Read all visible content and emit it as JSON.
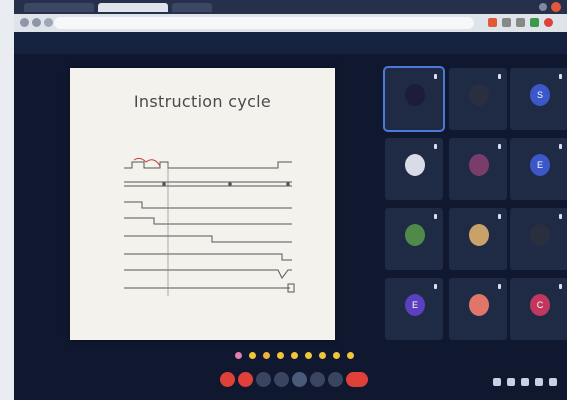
{
  "browser": {
    "tabs": [
      "",
      "",
      ""
    ],
    "url": ""
  },
  "presenter_bar": {
    "text": ""
  },
  "slide": {
    "title": "Instruction cycle",
    "note": "",
    "subtitle": "",
    "signals": [
      "",
      "",
      "",
      "",
      "",
      "",
      "",
      ""
    ]
  },
  "participants": [
    {
      "name": "",
      "avatar_letter": "",
      "color": "#1d1d3a",
      "active": true
    },
    {
      "name": "",
      "avatar_letter": "",
      "color": "#2a2f40"
    },
    {
      "name": "",
      "avatar_letter": "S",
      "color": "#3b57c9"
    },
    {
      "name": "",
      "avatar_letter": "",
      "color": "#d9dce6"
    },
    {
      "name": "",
      "avatar_letter": "",
      "color": "#7a3d6a"
    },
    {
      "name": "",
      "avatar_letter": "E",
      "color": "#3b57c9"
    },
    {
      "name": "",
      "avatar_letter": "",
      "color": "#4f8a4a"
    },
    {
      "name": "",
      "avatar_letter": "",
      "color": "#c9a26a"
    },
    {
      "name": "",
      "avatar_letter": "",
      "color": "#2a2f40"
    },
    {
      "name": "",
      "avatar_letter": "E",
      "color": "#5a3fbf"
    },
    {
      "name": "",
      "avatar_letter": "",
      "color": "#e0766a"
    },
    {
      "name": "",
      "avatar_letter": "C",
      "color": "#c2375f"
    }
  ],
  "footer": {
    "time_label": ""
  },
  "colors": {
    "leave_button": "#e0403a",
    "mic_off": "#e0403a",
    "toolbar": "#3a4560"
  }
}
